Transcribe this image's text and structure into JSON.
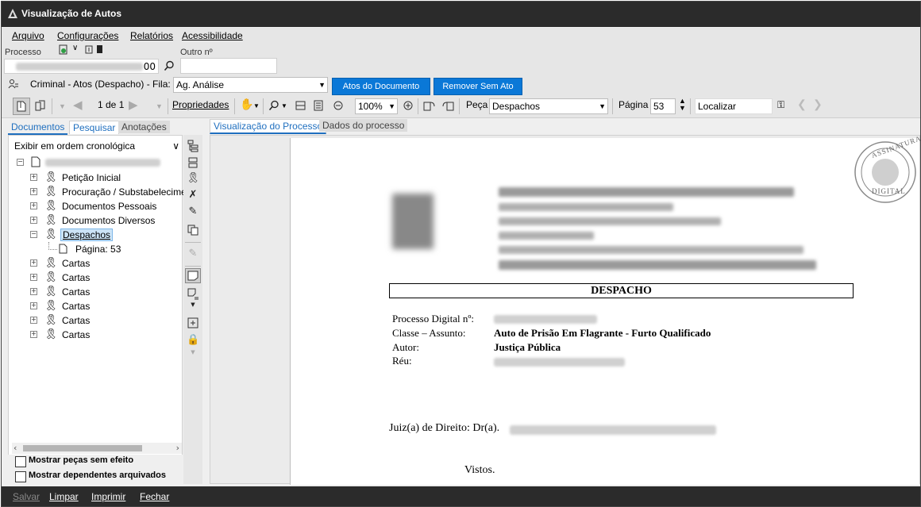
{
  "window": {
    "title": "Visualização de Autos"
  },
  "menu": {
    "items": [
      "Arquivo",
      "Configurações",
      "Relatórios",
      "Acessibilidade"
    ]
  },
  "process": {
    "label": "Processo",
    "number_suffix": "00",
    "other_label": "Outro nº",
    "other_value": ""
  },
  "queue": {
    "text": "Criminal - Atos (Despacho) - Fila:",
    "fila_value": "Ag. Análise"
  },
  "buttons": {
    "atos": "Atos do Documento",
    "remover": "Remover Sem Ato"
  },
  "toolbar": {
    "page_count": "1 de 1",
    "properties": "Propriedades",
    "zoom": "100%",
    "peca_label": "Peça",
    "peca_value": "Despachos",
    "pagina_label": "Página",
    "pagina_value": "53",
    "search_placeholder": "Localizar"
  },
  "left_tabs": [
    "Documentos",
    "Pesquisar",
    "Anotações"
  ],
  "order": {
    "value": "Exibir em ordem cronológica"
  },
  "tree": {
    "items": [
      {
        "label": "Petição Inicial"
      },
      {
        "label": "Procuração / Substabelecimen"
      },
      {
        "label": "Documentos Pessoais"
      },
      {
        "label": "Documentos Diversos"
      },
      {
        "label": "Despachos"
      },
      {
        "label": "Página: 53"
      },
      {
        "label": "Cartas"
      },
      {
        "label": "Cartas"
      },
      {
        "label": "Cartas"
      },
      {
        "label": "Cartas"
      },
      {
        "label": "Cartas"
      },
      {
        "label": "Cartas"
      }
    ]
  },
  "checkboxes": {
    "sem_efeito": "Mostrar peças sem efeito",
    "arquivados": "Mostrar dependentes arquivados"
  },
  "viewer_tabs": [
    "Visualização do Processo",
    "Dados do processo"
  ],
  "document": {
    "seal_top": "ASSINATURA",
    "seal_bottom": "DIGITAL",
    "heading": "DESPACHO",
    "fields": [
      {
        "label": "Processo Digital nº:",
        "value": ""
      },
      {
        "label": "Classe – Assunto:",
        "value": "Auto de Prisão Em Flagrante - Furto Qualificado"
      },
      {
        "label": "Autor:",
        "value": "Justiça Pública"
      },
      {
        "label": "Réu:",
        "value": ""
      }
    ],
    "judge": "Juiz(a) de Direito: Dr(a).",
    "vistos": "Vistos."
  },
  "bottom": {
    "salvar": "Salvar",
    "limpar": "Limpar",
    "imprimir": "Imprimir",
    "fechar": "Fechar"
  },
  "colors": {
    "titlebar": "#2b2b2b",
    "accent": "#0a78d7",
    "link": "#1f6fbf"
  }
}
